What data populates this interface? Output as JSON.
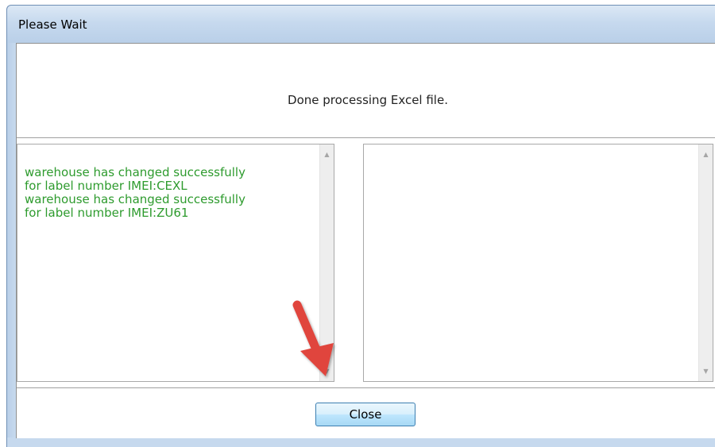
{
  "window": {
    "title": "Please Wait"
  },
  "status": {
    "message": "Done processing Excel file."
  },
  "logs": {
    "success_text": "warehouse has changed successfully\nfor label number IMEI:CEXL\nwarehouse has changed successfully\nfor label number IMEI:ZU61",
    "error_text": ""
  },
  "scroll": {
    "up_glyph": "▲",
    "down_glyph": "▼"
  },
  "buttons": {
    "close_label": "Close"
  },
  "colors": {
    "success_text": "#2e9b2e",
    "annotation_arrow": "#e0453d"
  }
}
